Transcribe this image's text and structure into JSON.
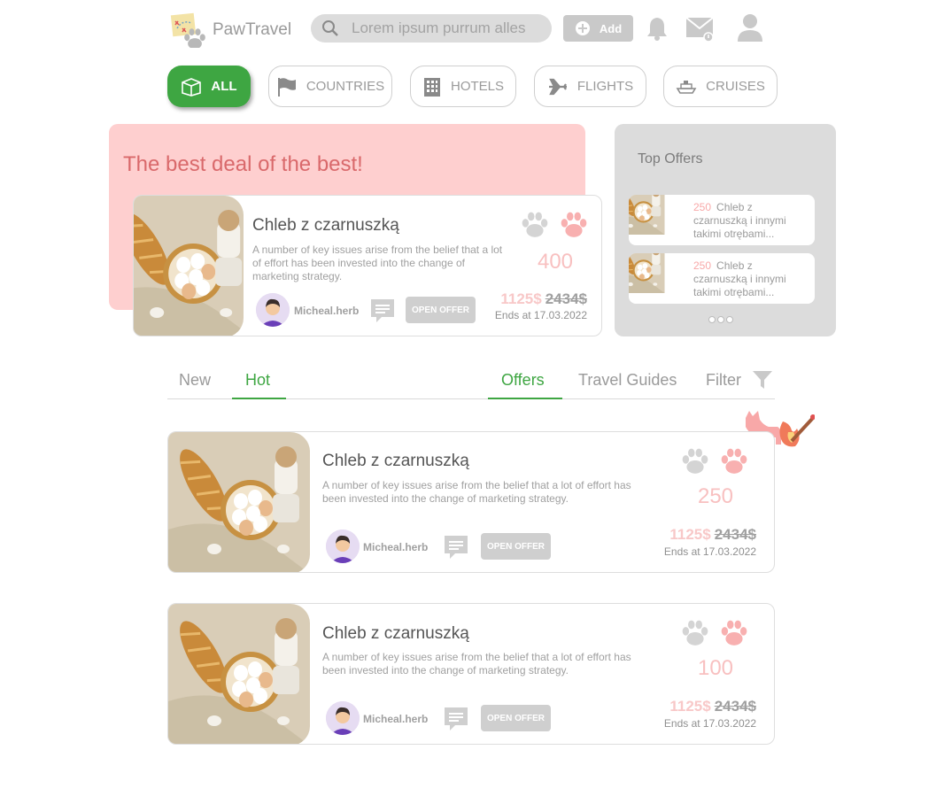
{
  "header": {
    "app_name": "PawTravel",
    "search_placeholder": "Lorem ipsum purrum alles",
    "add_label": "Add"
  },
  "categories": [
    {
      "label": "ALL",
      "icon": "box-icon",
      "active": true
    },
    {
      "label": "COUNTRIES",
      "icon": "flag-icon",
      "active": false
    },
    {
      "label": "HOTELS",
      "icon": "building-icon",
      "active": false
    },
    {
      "label": "FLIGHTS",
      "icon": "plane-icon",
      "active": false
    },
    {
      "label": "CRUISES",
      "icon": "ship-icon",
      "active": false
    }
  ],
  "hero": {
    "title": "The best deal of the best!",
    "card": {
      "title": "Chleb z czarnuszką",
      "description": "A number of key issues arise from the belief that a lot of effort has been invested into the change of marketing strategy.",
      "user": "Micheal.herb",
      "button": "OPEN OFFER",
      "points": "400",
      "price_new": "1125$",
      "price_old": "2434$",
      "ends": "Ends at 17.03.2022"
    }
  },
  "top_offers": {
    "title": "Top Offers",
    "items": [
      {
        "points": "250",
        "text": "Chleb z czarnuszką  i innymi takimi otrębami..."
      },
      {
        "points": "250",
        "text": "Chleb z czarnuszką  i innymi takimi otrębami..."
      }
    ]
  },
  "feed_tabs": {
    "left": [
      "New",
      "Hot"
    ],
    "left_active": "Hot",
    "right": [
      "Offers",
      "Travel Guides",
      "Filter"
    ],
    "right_active": "Offers"
  },
  "cards": [
    {
      "title": "Chleb z czarnuszką",
      "description": "A number of key issues arise from the belief that a lot of effort has been invested into the change of marketing strategy.",
      "user": "Micheal.herb",
      "button": "OPEN OFFER",
      "points": "250",
      "price_new": "1125$",
      "price_old": "2434$",
      "ends": "Ends at 17.03.2022"
    },
    {
      "title": "Chleb z czarnuszką",
      "description": "A number of key issues arise from the belief that a lot of effort has been invested into the change of marketing strategy.",
      "user": "Micheal.herb",
      "button": "OPEN OFFER",
      "points": "100",
      "price_new": "1125$",
      "price_old": "2434$",
      "ends": "Ends at 17.03.2022"
    }
  ],
  "colors": {
    "accent": "#3ea642",
    "hero_bg": "#fecfcf",
    "hero_title": "#d9696b",
    "points": "#f8c0c0",
    "muted": "#a0a0a0"
  }
}
